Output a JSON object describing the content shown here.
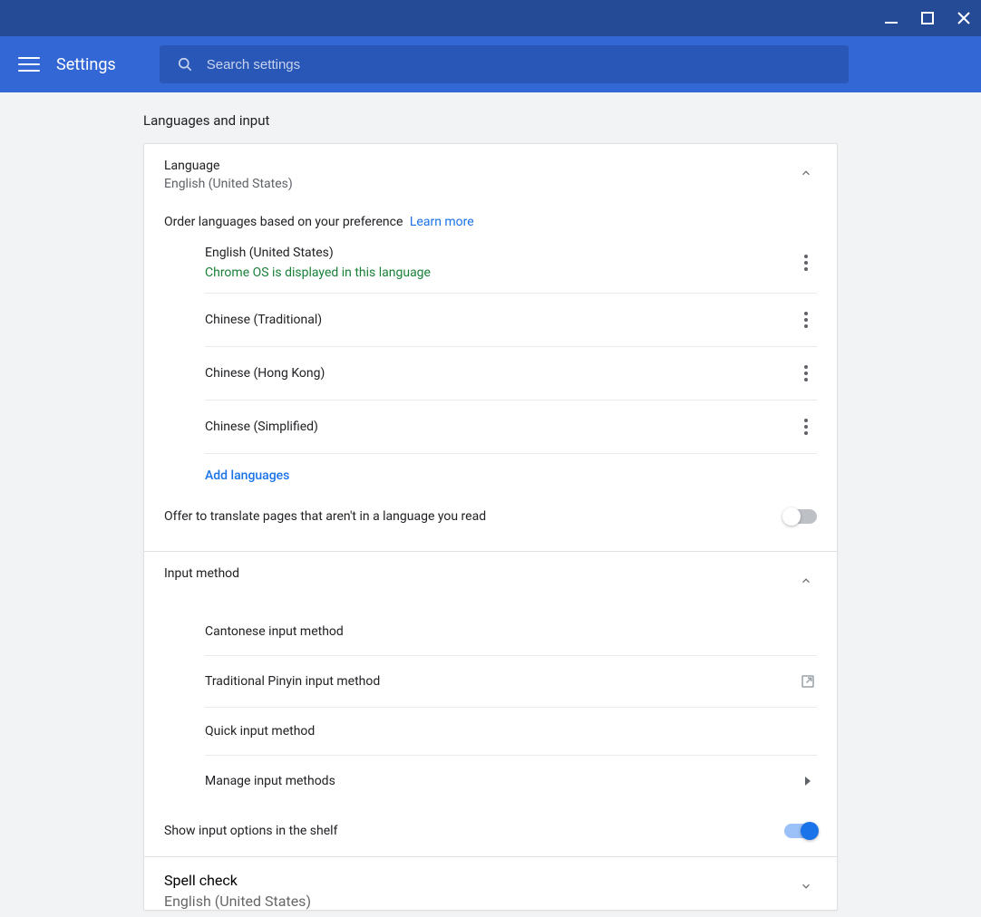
{
  "header": {
    "app_title": "Settings",
    "search_placeholder": "Search settings"
  },
  "page": {
    "title": "Languages and input"
  },
  "language_section": {
    "title": "Language",
    "subtitle": "English (United States)",
    "order_text": "Order languages based on your preference",
    "learn_more": "Learn more",
    "items": [
      {
        "name": "English (United States)",
        "hint": "Chrome OS is displayed in this language"
      },
      {
        "name": "Chinese (Traditional)"
      },
      {
        "name": "Chinese (Hong Kong)"
      },
      {
        "name": "Chinese (Simplified)"
      }
    ],
    "add_label": "Add languages",
    "translate_toggle_label": "Offer to translate pages that aren't in a language you read",
    "translate_on": false
  },
  "input_section": {
    "title": "Input method",
    "items": [
      {
        "name": "Cantonese input method",
        "action": "none"
      },
      {
        "name": "Traditional Pinyin input method",
        "action": "open"
      },
      {
        "name": "Quick input method",
        "action": "none"
      },
      {
        "name": "Manage input methods",
        "action": "arrow"
      }
    ],
    "shelf_toggle_label": "Show input options in the shelf",
    "shelf_on": true
  },
  "spell_section": {
    "title": "Spell check",
    "subtitle": "English (United States)"
  }
}
